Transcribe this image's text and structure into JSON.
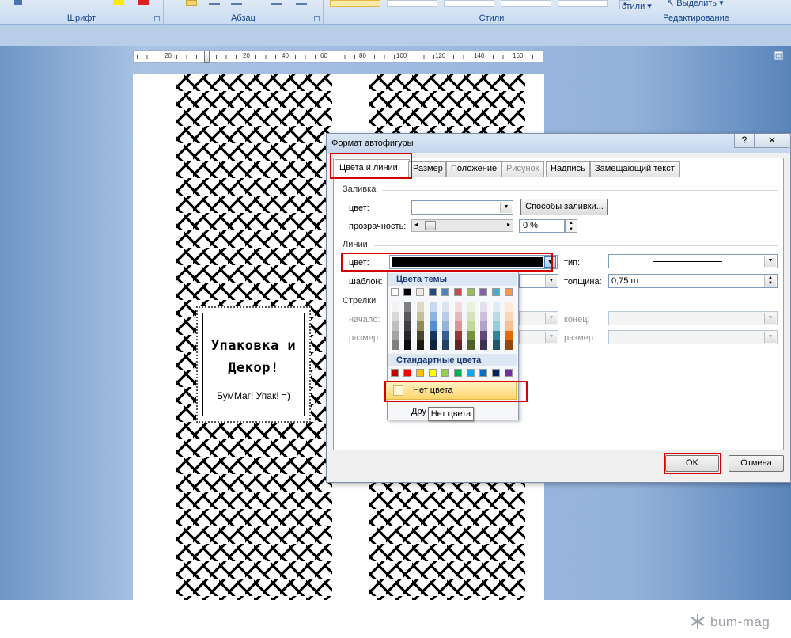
{
  "ribbon": {
    "groups": {
      "font": "Шрифт",
      "paragraph": "Абзац",
      "styles": "Стили",
      "editing": "Редактирование"
    },
    "change_styles": "стили",
    "select": "Выделить"
  },
  "ruler": {
    "ticks": [
      "20",
      "20",
      "40",
      "60",
      "80",
      "100",
      "120",
      "140",
      "160"
    ]
  },
  "document": {
    "label_title_1": "Упаковка и",
    "label_title_2": "Декор!",
    "label_subtitle": "БумМаг! Упак! =)"
  },
  "dialog": {
    "title": "Формат автофигуры",
    "help": "?",
    "close": "✕",
    "tabs": [
      {
        "label": "Цвета и линии"
      },
      {
        "label": "Размер"
      },
      {
        "label": "Положение"
      },
      {
        "label": "Рисунок"
      },
      {
        "label": "Надпись"
      },
      {
        "label": "Замещающий текст"
      }
    ],
    "fill": {
      "section": "Заливка",
      "color_label": "цвет:",
      "methods_button": "Способы заливки...",
      "transparency_label": "прозрачность:",
      "transparency_value": "0 %"
    },
    "lines": {
      "section": "Линии",
      "color_label": "цвет:",
      "color_value": "#000000",
      "type_label": "тип:",
      "pattern_label": "шаблон:",
      "weight_label": "толщина:",
      "weight_value": "0,75 пт"
    },
    "arrows": {
      "section": "Стрелки",
      "start_label": "начало:",
      "end_label": "конец:",
      "size_label": "размер:",
      "size_label_2": "размер:"
    },
    "ok": "OK",
    "cancel": "Отмена"
  },
  "color_dropdown": {
    "theme_header": "Цвета темы",
    "standard_header": "Стандартные цвета",
    "no_color": "Нет цвета",
    "more_colors": "Дру",
    "tooltip": "Нет цвета",
    "theme_top": [
      "#ffffff",
      "#000000",
      "#eeece1",
      "#1f497d",
      "#4f81bd",
      "#c0504d",
      "#9bbb59",
      "#8064a2",
      "#4bacc6",
      "#f79646"
    ],
    "theme_shades": [
      [
        "#f2f2f2",
        "#7f7f7f",
        "#ddd9c3",
        "#c6d9f0",
        "#dbe5f1",
        "#f2dcdb",
        "#ebf1dd",
        "#e5e0ec",
        "#dbeef3",
        "#fdeada"
      ],
      [
        "#d8d8d8",
        "#595959",
        "#c4bd97",
        "#8db3e2",
        "#b8cce4",
        "#e5b9b7",
        "#d7e3bc",
        "#ccc1d9",
        "#b7dde8",
        "#fbd5b5"
      ],
      [
        "#bfbfbf",
        "#3f3f3f",
        "#938953",
        "#548dd4",
        "#95b3d7",
        "#d99694",
        "#c3d69b",
        "#b2a2c7",
        "#92cddc",
        "#fac08f"
      ],
      [
        "#a5a5a5",
        "#262626",
        "#494429",
        "#17365d",
        "#366092",
        "#953734",
        "#76923c",
        "#5f497a",
        "#31859b",
        "#e36c09"
      ],
      [
        "#7f7f7f",
        "#0c0c0c",
        "#1d1b10",
        "#0f243e",
        "#244061",
        "#632423",
        "#4f6128",
        "#3f3151",
        "#205867",
        "#974806"
      ]
    ],
    "standard": [
      "#c00000",
      "#ff0000",
      "#ffc000",
      "#ffff00",
      "#92d050",
      "#00b050",
      "#00b0f0",
      "#0070c0",
      "#002060",
      "#7030a0"
    ]
  },
  "watermark": "bum-mag"
}
